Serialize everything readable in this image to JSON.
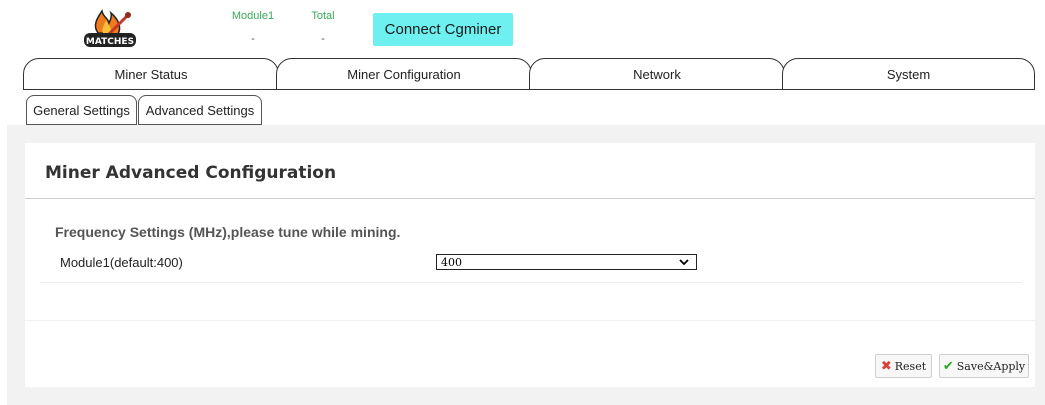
{
  "header": {
    "logo_text": "MATCHES",
    "stats": [
      {
        "label": "Module1",
        "value": "-"
      },
      {
        "label": "Total",
        "value": "-"
      }
    ],
    "connect_label": "Connect Cgminer"
  },
  "main_tabs": [
    {
      "label": "Miner Status"
    },
    {
      "label": "Miner Configuration"
    },
    {
      "label": "Network"
    },
    {
      "label": "System"
    }
  ],
  "sub_tabs": [
    {
      "label": "General Settings"
    },
    {
      "label": "Advanced Settings"
    }
  ],
  "panel": {
    "title": "Miner Advanced Configuration",
    "section_title": "Frequency Settings (MHz),please tune while mining.",
    "fields": [
      {
        "label": "Module1(default:400)",
        "value": "400"
      }
    ]
  },
  "actions": {
    "reset_label": "Reset",
    "save_label": "Save&Apply"
  },
  "colors": {
    "connect_button": "#6ff0f0",
    "stat_label": "#3aaa5c",
    "reset_icon": "#d9413a",
    "save_icon": "#2aa52a",
    "content_background": "#f2f2f2"
  },
  "icons": [
    "matches-logo-icon",
    "chevron-down-icon",
    "close-icon",
    "checkmark-icon"
  ]
}
